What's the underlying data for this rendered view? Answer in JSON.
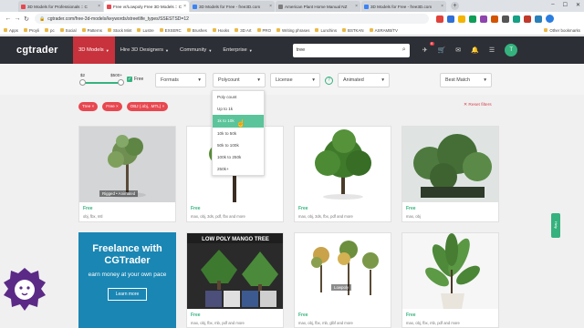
{
  "browser": {
    "tabs": [
      {
        "label": "3D Models for Professionals :: C",
        "color": "#e8474f",
        "active": false
      },
      {
        "label": "Free vr/Lowpoly Free 3D Models :: C",
        "color": "#e8474f",
        "active": true
      },
      {
        "label": "3D Models for Free - free3D.com",
        "color": "#3b82f6",
        "active": false
      },
      {
        "label": "American Plant Home Manual NZ",
        "color": "#7d7d7d",
        "active": false
      },
      {
        "label": "3D Models for Free - free3D.com",
        "color": "#3b82f6",
        "active": false
      }
    ],
    "new_tab": "+",
    "window_buttons": [
      "–",
      "☐",
      "✕"
    ],
    "url": "cgtrader.com/free-3d-models/keywords/streetlife_types/SSESTSD=12",
    "bookmarks": [
      "Apps",
      "Proyli",
      "pc",
      "Social",
      "Patterns",
      "Stock Mint",
      "Lustre",
      "EXSERC",
      "Brushes",
      "Hooks",
      "3D Art",
      "PRO",
      "Writing phrases",
      "Lunchins",
      "BSTKAN",
      "ASRAMB/TV"
    ],
    "bookmarks_other": "Other bookmarks"
  },
  "header": {
    "logo": "cgtrader",
    "nav": [
      {
        "label": "3D Models",
        "active": true
      },
      {
        "label": "Hire 3D Designers",
        "active": false
      },
      {
        "label": "Community",
        "active": false
      },
      {
        "label": "Enterprise",
        "active": false
      }
    ],
    "search_value": "tree",
    "notification_count": "9"
  },
  "filters": {
    "price_min": "$2",
    "price_max": "$500+",
    "free_label": "Free",
    "formats_label": "Formats",
    "polycount_label": "Polycount",
    "license_label": "License",
    "animation_label": "Animated",
    "sort_label": "Best Match",
    "polycount_options": [
      "Poly count",
      "Up to 1k",
      "1k to 10k",
      "10k to 50k",
      "50k to 100k",
      "100k to 250k",
      "250k+"
    ],
    "active_tags": [
      "Tree ×",
      "Free ×",
      "OBJ (.obj, .MTL) ×"
    ],
    "reset_label": "✕ Reset filters"
  },
  "products": [
    {
      "title": "Free",
      "formats": "obj, fbx, mtl",
      "overlay": "Rigged • Animated"
    },
    {
      "title": "Free",
      "formats": "max, obj, 3ds, pdf, fbx and more",
      "overlay": ""
    },
    {
      "title": "Free",
      "formats": "max, obj, 3ds, fbx, pdf and more",
      "overlay": ""
    },
    {
      "title": "Free",
      "formats": "max, obj",
      "overlay": ""
    },
    {
      "title": "Free",
      "formats": "max, obj, fbx, mb, pdf and more",
      "overlay": ""
    },
    {
      "title": "Free",
      "formats": "max, obj, fbx, mb, glbf and more",
      "overlay": "Lowpoly"
    },
    {
      "title": "Free",
      "formats": "max, obj, fbx, mb, pdf and more",
      "overlay": ""
    }
  ],
  "product_banners": {
    "lowpoly_mango": "LOW POLY MANGO TREE"
  },
  "promo": {
    "title": "Freelance with CGTrader",
    "subtitle": "earn money at your own pace",
    "button": "Learn more"
  },
  "side_tab": "Help"
}
